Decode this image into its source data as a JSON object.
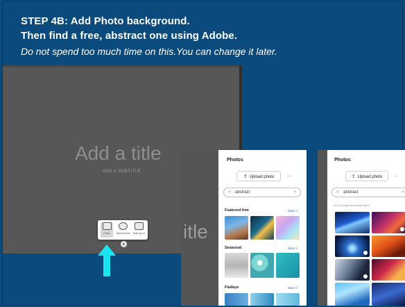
{
  "instructions": {
    "line1": "STEP 4B: Add Photo background.",
    "line2": "Then find a free, abstract one using Adobe.",
    "note": "Do not spend too much time on this.You can change it later."
  },
  "editor": {
    "title_placeholder": "Add a title",
    "subtitle_placeholder": "ADD A SUBTITLE",
    "title_fragment": "itle"
  },
  "toolbar": {
    "items": [
      {
        "label": "Photo",
        "icon": "photo-icon"
      },
      {
        "label": "Brand theme",
        "icon": "theme-icon"
      },
      {
        "label": "Split layout",
        "icon": "layout-icon"
      }
    ],
    "add": "+"
  },
  "arrow_color": "#19e6f0",
  "panel1": {
    "title": "Photos",
    "upload_label": "Upload photo",
    "more_dots": "...",
    "search_value": "abstract",
    "clear": "×",
    "sections": [
      {
        "heading": "Featured free",
        "more": "More >"
      },
      {
        "heading": "Seasonal",
        "more": "More >"
      },
      {
        "heading": "Flatlays",
        "more": "More >"
      }
    ]
  },
  "panel2": {
    "title": "Photos",
    "upload_label": "Upload photo",
    "more_dots": "...",
    "search_value": "abstract",
    "clear": "×",
    "results": "123,123 results from Adobe Stock"
  }
}
